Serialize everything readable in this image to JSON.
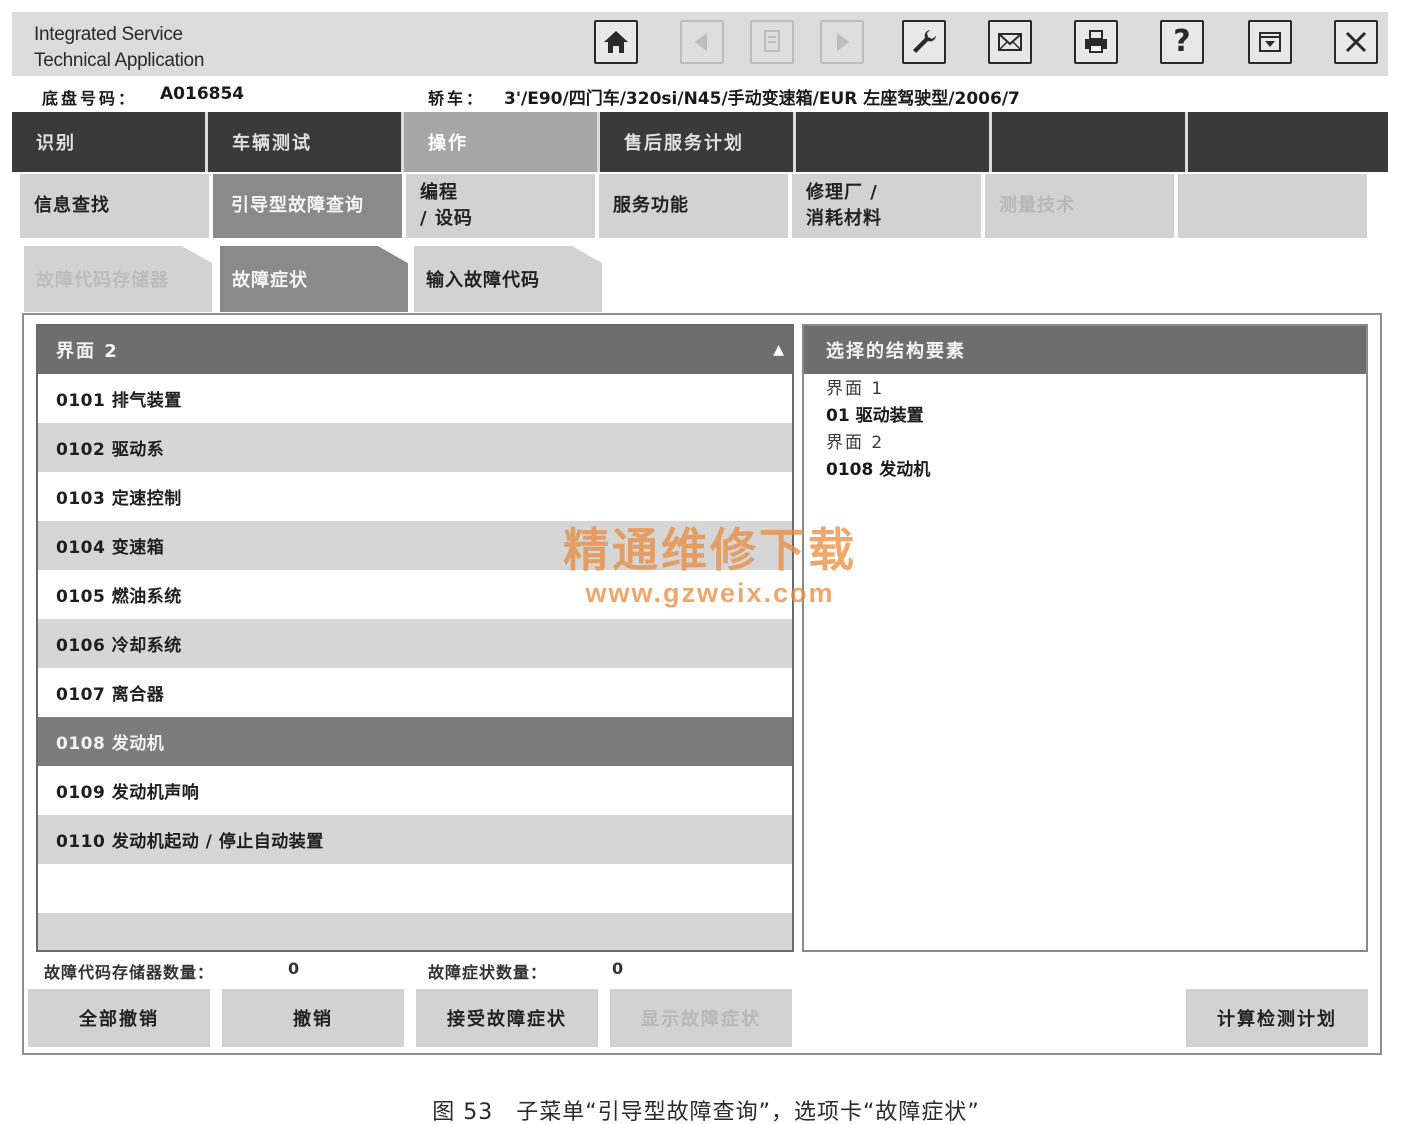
{
  "header": {
    "title_line1": "Integrated Service",
    "title_line2": "Technical Application",
    "toolbar": [
      {
        "name": "home-button",
        "icon": "home-icon",
        "enabled": true
      },
      {
        "name": "back-button",
        "icon": "arrow-left-icon",
        "enabled": false
      },
      {
        "name": "document-button",
        "icon": "document-icon",
        "enabled": false
      },
      {
        "name": "forward-button",
        "icon": "arrow-right-icon",
        "enabled": false
      },
      {
        "name": "tools-button",
        "icon": "wrench-icon",
        "enabled": true
      },
      {
        "name": "mail-button",
        "icon": "envelope-icon",
        "enabled": true
      },
      {
        "name": "print-button",
        "icon": "printer-icon",
        "enabled": true
      },
      {
        "name": "help-button",
        "icon": "question-icon",
        "label": "?",
        "enabled": true
      },
      {
        "name": "minimize-button",
        "icon": "minimize-icon",
        "enabled": true
      },
      {
        "name": "close-button",
        "icon": "close-icon",
        "enabled": true
      }
    ]
  },
  "vehicle": {
    "chassis_label": "底盘号码：",
    "chassis_value": "A016854",
    "model_label": "轿车：",
    "model_value": "3'/E90/四门车/320si/N45/手动变速箱/EUR 左座驾驶型/2006/7"
  },
  "main_nav": [
    {
      "label": "识别",
      "active": false
    },
    {
      "label": "车辆测试",
      "active": false
    },
    {
      "label": "操作",
      "active": true
    },
    {
      "label": "售后服务计划",
      "active": false
    },
    {
      "label": "",
      "active": false
    },
    {
      "label": "",
      "active": false
    },
    {
      "label": "",
      "active": false
    }
  ],
  "sub_nav": [
    {
      "label": "信息查找",
      "state": "normal"
    },
    {
      "label": "引导型故障查询",
      "state": "active"
    },
    {
      "label1": "编程",
      "label2": "/ 设码",
      "state": "normal"
    },
    {
      "label": "服务功能",
      "state": "normal"
    },
    {
      "label1": "修理厂 /",
      "label2": "消耗材料",
      "state": "normal"
    },
    {
      "label": "测量技术",
      "state": "disabled"
    },
    {
      "label": "",
      "state": "normal"
    }
  ],
  "tabs": [
    {
      "label": "故障代码存储器",
      "state": "disabled"
    },
    {
      "label": "故障症状",
      "state": "active"
    },
    {
      "label": "输入故障代码",
      "state": "normal"
    }
  ],
  "list": {
    "header": "界面 2",
    "sort_arrow": "▲",
    "items": [
      "0101 排气装置",
      "0102 驱动系",
      "0103 定速控制",
      "0104 变速箱",
      "0105 燃油系统",
      "0106 冷却系统",
      "0107 离合器",
      "0108 发动机",
      "0109 发动机声响",
      "0110 发动机起动 / 停止自动装置"
    ],
    "selected_index": 7
  },
  "selection": {
    "header": "选择的结构要素",
    "level1_label": "界面 1",
    "level1_value": "01 驱动装置",
    "level2_label": "界面 2",
    "level2_value": "0108 发动机"
  },
  "counts": {
    "dtc_label": "故障代码存储器数量：",
    "dtc_value": "0",
    "symptom_label": "故障症状数量：",
    "symptom_value": "0"
  },
  "buttons": {
    "cancel_all": "全部撤销",
    "cancel": "撤销",
    "accept_symptom": "接受故障症状",
    "show_symptom": "显示故障症状",
    "calc_plan": "计算检测计划"
  },
  "watermark": {
    "cn": "精通维修下载",
    "url": "www.gzweix.com"
  },
  "caption": "图 53　子菜单“引导型故障查询”，选项卡“故障症状”"
}
